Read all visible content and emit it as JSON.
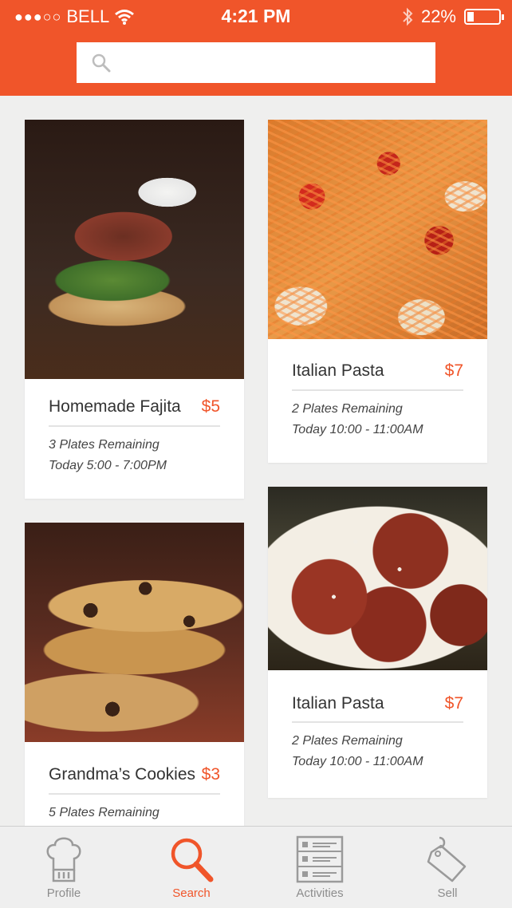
{
  "status_bar": {
    "signal": "●●●○○",
    "carrier": "BELL",
    "time": "4:21 PM",
    "battery": "22%",
    "battery_level": 0.22
  },
  "search": {
    "placeholder": ""
  },
  "colors": {
    "accent": "#f0552a",
    "background": "#efefee"
  },
  "listings": [
    {
      "title": "Homemade Fajita",
      "price": "$5",
      "plates": "3 Plates Remaining",
      "time": "Today 5:00 - 7:00PM",
      "image": "fajita-photo"
    },
    {
      "title": "Italian Pasta",
      "price": "$7",
      "plates": "2 Plates Remaining",
      "time": "Today 10:00 - 11:00AM",
      "image": "pasta-photo"
    },
    {
      "title": "Grandma’s Cookies",
      "price": "$3",
      "plates": "5 Plates Remaining",
      "time": "",
      "image": "cookies-photo"
    },
    {
      "title": "Italian Pasta",
      "price": "$7",
      "plates": "2 Plates Remaining",
      "time": "Today 10:00 - 11:00AM",
      "image": "meatballs-photo"
    }
  ],
  "tabs": [
    {
      "label": "Profile",
      "icon": "chef-hat-icon",
      "active": false
    },
    {
      "label": "Search",
      "icon": "search-icon",
      "active": true
    },
    {
      "label": "Activities",
      "icon": "list-icon",
      "active": false
    },
    {
      "label": "Sell",
      "icon": "price-tag-icon",
      "active": false
    }
  ]
}
